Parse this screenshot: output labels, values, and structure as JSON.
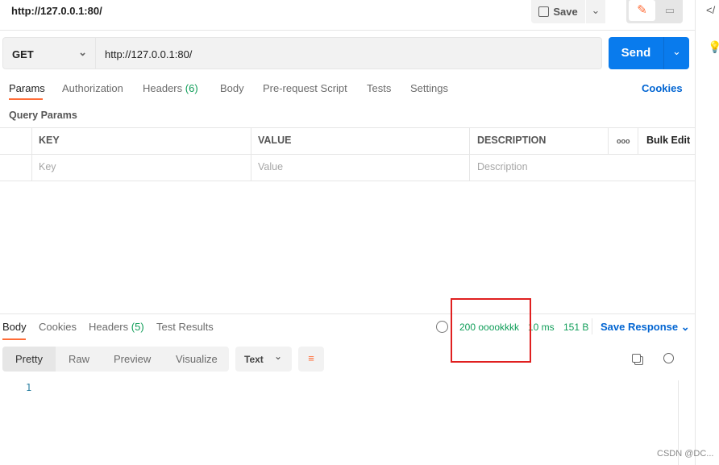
{
  "request": {
    "title": "http://127.0.0.1:80/",
    "save_label": "Save",
    "method": "GET",
    "url": "http://127.0.0.1:80/",
    "send_label": "Send"
  },
  "tabs": [
    {
      "label": "Params"
    },
    {
      "label": "Authorization"
    },
    {
      "label": "Headers",
      "count": "(6)"
    },
    {
      "label": "Body"
    },
    {
      "label": "Pre-request Script"
    },
    {
      "label": "Tests"
    },
    {
      "label": "Settings"
    }
  ],
  "cookies_link": "Cookies",
  "query_params": {
    "title": "Query Params",
    "columns": [
      "KEY",
      "VALUE",
      "DESCRIPTION"
    ],
    "more": "ooo",
    "bulk_edit": "Bulk Edit",
    "placeholders": [
      "Key",
      "Value",
      "Description"
    ]
  },
  "response": {
    "tabs": [
      {
        "label": "Body"
      },
      {
        "label": "Cookies"
      },
      {
        "label": "Headers",
        "count": "(5)"
      },
      {
        "label": "Test Results"
      }
    ],
    "status": "200 ooookkkk",
    "time": "10 ms",
    "size": "151 B",
    "save_response": "Save Response",
    "views": [
      "Pretty",
      "Raw",
      "Preview",
      "Visualize"
    ],
    "format": "Text",
    "line_number": "1"
  },
  "watermark": "CSDN @DC...",
  "colors": {
    "accent": "#ff6c37",
    "send": "#097bed",
    "link": "#0265d2",
    "status": "#0f9d58",
    "highlight_box": "#e02020"
  }
}
